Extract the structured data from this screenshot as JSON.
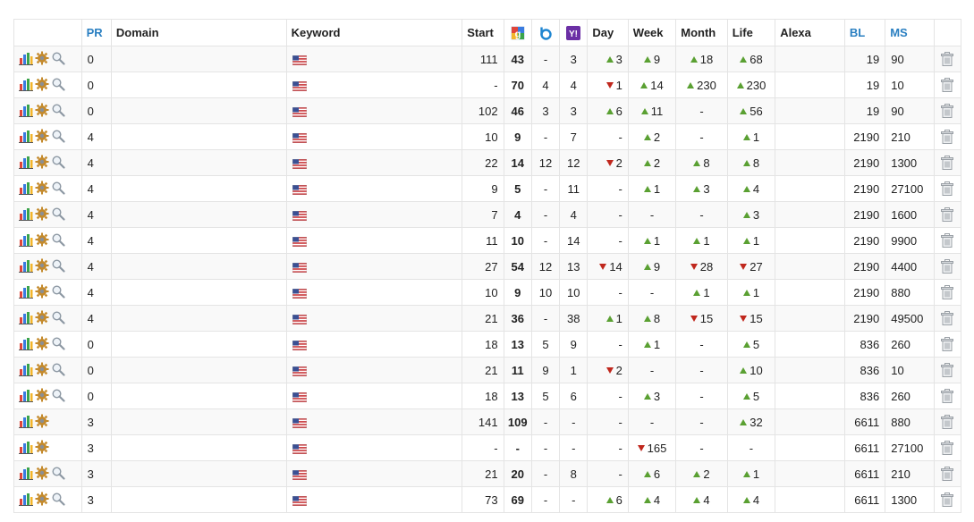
{
  "headers": {
    "pr": "PR",
    "domain": "Domain",
    "keyword": "Keyword",
    "start": "Start",
    "google_icon": "google-icon",
    "bing_icon": "bing-icon",
    "yahoo_icon": "yahoo-icon",
    "day": "Day",
    "week": "Week",
    "month": "Month",
    "life": "Life",
    "alexa": "Alexa",
    "bl": "BL",
    "ms": "MS"
  },
  "colors": {
    "accent": "#2a7fc1",
    "up": "#5aa032",
    "down": "#c0271d"
  },
  "rows": [
    {
      "pr": "0",
      "domain": "",
      "keyword": "",
      "start": "111",
      "google": "43",
      "bing": "-",
      "yahoo": "3",
      "day": {
        "dir": "up",
        "val": "3"
      },
      "week": {
        "dir": "up",
        "val": "9"
      },
      "month": {
        "dir": "up",
        "val": "18"
      },
      "life": {
        "dir": "up",
        "val": "68"
      },
      "alexa": "",
      "bl": "19",
      "ms": "90",
      "search": true
    },
    {
      "pr": "0",
      "domain": "",
      "keyword": "",
      "start": "-",
      "google": "70",
      "bing": "4",
      "yahoo": "4",
      "day": {
        "dir": "down",
        "val": "1"
      },
      "week": {
        "dir": "up",
        "val": "14"
      },
      "month": {
        "dir": "up",
        "val": "230"
      },
      "life": {
        "dir": "up",
        "val": "230"
      },
      "alexa": "",
      "bl": "19",
      "ms": "10",
      "search": true
    },
    {
      "pr": "0",
      "domain": "",
      "keyword": "",
      "start": "102",
      "google": "46",
      "bing": "3",
      "yahoo": "3",
      "day": {
        "dir": "up",
        "val": "6"
      },
      "week": {
        "dir": "up",
        "val": "11"
      },
      "month": {
        "dir": "none",
        "val": "-"
      },
      "life": {
        "dir": "up",
        "val": "56"
      },
      "alexa": "",
      "bl": "19",
      "ms": "90",
      "search": true
    },
    {
      "pr": "4",
      "domain": "",
      "keyword": "",
      "start": "10",
      "google": "9",
      "bing": "-",
      "yahoo": "7",
      "day": {
        "dir": "none",
        "val": "-"
      },
      "week": {
        "dir": "up",
        "val": "2"
      },
      "month": {
        "dir": "none",
        "val": "-"
      },
      "life": {
        "dir": "up",
        "val": "1"
      },
      "alexa": "",
      "bl": "2190",
      "ms": "210",
      "search": true
    },
    {
      "pr": "4",
      "domain": "",
      "keyword": "",
      "start": "22",
      "google": "14",
      "bing": "12",
      "yahoo": "12",
      "day": {
        "dir": "down",
        "val": "2"
      },
      "week": {
        "dir": "up",
        "val": "2"
      },
      "month": {
        "dir": "up",
        "val": "8"
      },
      "life": {
        "dir": "up",
        "val": "8"
      },
      "alexa": "",
      "bl": "2190",
      "ms": "1300",
      "search": true
    },
    {
      "pr": "4",
      "domain": "",
      "keyword": "",
      "start": "9",
      "google": "5",
      "bing": "-",
      "yahoo": "11",
      "day": {
        "dir": "none",
        "val": "-"
      },
      "week": {
        "dir": "up",
        "val": "1"
      },
      "month": {
        "dir": "up",
        "val": "3"
      },
      "life": {
        "dir": "up",
        "val": "4"
      },
      "alexa": "",
      "bl": "2190",
      "ms": "27100",
      "search": true
    },
    {
      "pr": "4",
      "domain": "",
      "keyword": "",
      "start": "7",
      "google": "4",
      "bing": "-",
      "yahoo": "4",
      "day": {
        "dir": "none",
        "val": "-"
      },
      "week": {
        "dir": "none",
        "val": "-"
      },
      "month": {
        "dir": "none",
        "val": "-"
      },
      "life": {
        "dir": "up",
        "val": "3"
      },
      "alexa": "",
      "bl": "2190",
      "ms": "1600",
      "search": true
    },
    {
      "pr": "4",
      "domain": "",
      "keyword": "",
      "start": "11",
      "google": "10",
      "bing": "-",
      "yahoo": "14",
      "day": {
        "dir": "none",
        "val": "-"
      },
      "week": {
        "dir": "up",
        "val": "1"
      },
      "month": {
        "dir": "up",
        "val": "1"
      },
      "life": {
        "dir": "up",
        "val": "1"
      },
      "alexa": "",
      "bl": "2190",
      "ms": "9900",
      "search": true
    },
    {
      "pr": "4",
      "domain": "",
      "keyword": "",
      "start": "27",
      "google": "54",
      "bing": "12",
      "yahoo": "13",
      "day": {
        "dir": "down",
        "val": "14"
      },
      "week": {
        "dir": "up",
        "val": "9"
      },
      "month": {
        "dir": "down",
        "val": "28"
      },
      "life": {
        "dir": "down",
        "val": "27"
      },
      "alexa": "",
      "bl": "2190",
      "ms": "4400",
      "search": true
    },
    {
      "pr": "4",
      "domain": "",
      "keyword": "",
      "start": "10",
      "google": "9",
      "bing": "10",
      "yahoo": "10",
      "day": {
        "dir": "none",
        "val": "-"
      },
      "week": {
        "dir": "none",
        "val": "-"
      },
      "month": {
        "dir": "up",
        "val": "1"
      },
      "life": {
        "dir": "up",
        "val": "1"
      },
      "alexa": "",
      "bl": "2190",
      "ms": "880",
      "search": true
    },
    {
      "pr": "4",
      "domain": "",
      "keyword": "",
      "start": "21",
      "google": "36",
      "bing": "-",
      "yahoo": "38",
      "day": {
        "dir": "up",
        "val": "1"
      },
      "week": {
        "dir": "up",
        "val": "8"
      },
      "month": {
        "dir": "down",
        "val": "15"
      },
      "life": {
        "dir": "down",
        "val": "15"
      },
      "alexa": "",
      "bl": "2190",
      "ms": "49500",
      "search": true
    },
    {
      "pr": "0",
      "domain": "",
      "keyword": "",
      "start": "18",
      "google": "13",
      "bing": "5",
      "yahoo": "9",
      "day": {
        "dir": "none",
        "val": "-"
      },
      "week": {
        "dir": "up",
        "val": "1"
      },
      "month": {
        "dir": "none",
        "val": "-"
      },
      "life": {
        "dir": "up",
        "val": "5"
      },
      "alexa": "",
      "bl": "836",
      "ms": "260",
      "search": true
    },
    {
      "pr": "0",
      "domain": "",
      "keyword": "",
      "start": "21",
      "google": "11",
      "bing": "9",
      "yahoo": "1",
      "day": {
        "dir": "down",
        "val": "2"
      },
      "week": {
        "dir": "none",
        "val": "-"
      },
      "month": {
        "dir": "none",
        "val": "-"
      },
      "life": {
        "dir": "up",
        "val": "10"
      },
      "alexa": "",
      "bl": "836",
      "ms": "10",
      "search": true
    },
    {
      "pr": "0",
      "domain": "",
      "keyword": "",
      "start": "18",
      "google": "13",
      "bing": "5",
      "yahoo": "6",
      "day": {
        "dir": "none",
        "val": "-"
      },
      "week": {
        "dir": "up",
        "val": "3"
      },
      "month": {
        "dir": "none",
        "val": "-"
      },
      "life": {
        "dir": "up",
        "val": "5"
      },
      "alexa": "",
      "bl": "836",
      "ms": "260",
      "search": true
    },
    {
      "pr": "3",
      "domain": "",
      "keyword": "",
      "start": "141",
      "google": "109",
      "bing": "-",
      "yahoo": "-",
      "day": {
        "dir": "none",
        "val": "-"
      },
      "week": {
        "dir": "none",
        "val": "-"
      },
      "month": {
        "dir": "none",
        "val": "-"
      },
      "life": {
        "dir": "up",
        "val": "32"
      },
      "alexa": "",
      "bl": "6611",
      "ms": "880",
      "search": false
    },
    {
      "pr": "3",
      "domain": "",
      "keyword": "",
      "start": "-",
      "google": "-",
      "bing": "-",
      "yahoo": "-",
      "day": {
        "dir": "none",
        "val": "-"
      },
      "week": {
        "dir": "down",
        "val": "165"
      },
      "month": {
        "dir": "none",
        "val": "-"
      },
      "life": {
        "dir": "none",
        "val": "-"
      },
      "alexa": "",
      "bl": "6611",
      "ms": "27100",
      "search": false
    },
    {
      "pr": "3",
      "domain": "",
      "keyword": "",
      "start": "21",
      "google": "20",
      "bing": "-",
      "yahoo": "8",
      "day": {
        "dir": "none",
        "val": "-"
      },
      "week": {
        "dir": "up",
        "val": "6"
      },
      "month": {
        "dir": "up",
        "val": "2"
      },
      "life": {
        "dir": "up",
        "val": "1"
      },
      "alexa": "",
      "bl": "6611",
      "ms": "210",
      "search": true
    },
    {
      "pr": "3",
      "domain": "",
      "keyword": "",
      "start": "73",
      "google": "69",
      "bing": "-",
      "yahoo": "-",
      "day": {
        "dir": "up",
        "val": "6"
      },
      "week": {
        "dir": "up",
        "val": "4"
      },
      "month": {
        "dir": "up",
        "val": "4"
      },
      "life": {
        "dir": "up",
        "val": "4"
      },
      "alexa": "",
      "bl": "6611",
      "ms": "1300",
      "search": true
    }
  ]
}
